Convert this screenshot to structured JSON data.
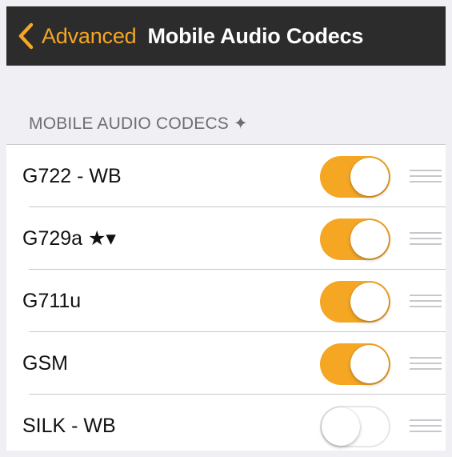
{
  "nav": {
    "back_label": "Advanced",
    "title": "Mobile Audio Codecs"
  },
  "section": {
    "header": "MOBILE AUDIO CODECS ✦"
  },
  "codecs": [
    {
      "label": "G722 - WB",
      "enabled": true
    },
    {
      "label": "G729a ★▾",
      "enabled": true
    },
    {
      "label": "G711u",
      "enabled": true
    },
    {
      "label": "GSM",
      "enabled": true
    },
    {
      "label": "SILK - WB",
      "enabled": false
    }
  ],
  "colors": {
    "accent": "#f5a623",
    "navbar": "#2c2c2c",
    "background": "#efeff4"
  },
  "icons": {
    "back": "chevron-left-icon",
    "reorder": "reorder-grip-icon"
  }
}
